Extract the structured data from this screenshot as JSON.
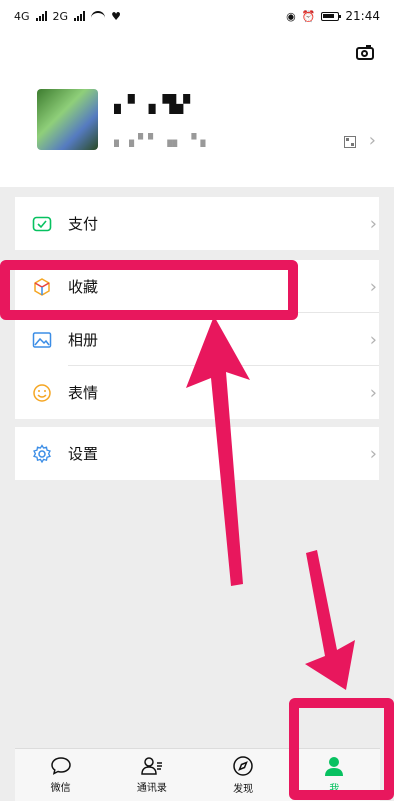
{
  "status": {
    "left_signal1": "4G",
    "left_signal2": "2G",
    "time": "21:44"
  },
  "profile": {
    "nickname": "▖▘▗▝▙▘",
    "wechat_id": "▖▗ ▘▘ ▗▖ ▝ ▖",
    "camera_icon": "camera-icon",
    "qr_icon": "qr-code-icon"
  },
  "menu": {
    "pay": "支付",
    "favorites": "收藏",
    "album": "相册",
    "emoji": "表情",
    "settings": "设置"
  },
  "tabs": [
    {
      "label": "微信"
    },
    {
      "label": "通讯录"
    },
    {
      "label": "发现"
    },
    {
      "label": "我"
    }
  ],
  "colors": {
    "accent": "#07c160",
    "annotation": "#e8175d"
  }
}
